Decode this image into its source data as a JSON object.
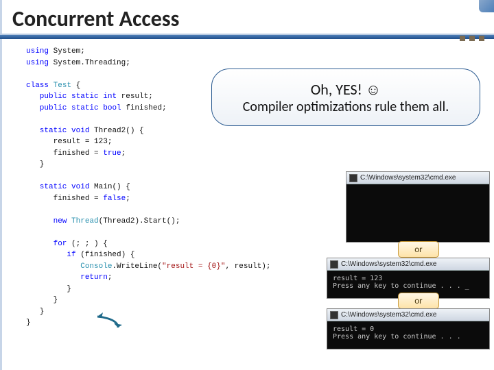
{
  "title": "Concurrent Access",
  "callout": {
    "line1": "Oh, YES! ☺",
    "line2": "Compiler optimizations rule them all."
  },
  "or_label": "or",
  "code": {
    "l01a": "using",
    "l01b": " System;",
    "l02a": "using",
    "l02b": " System.Threading;",
    "l03a": "class",
    "l03b": " Test",
    "l03c": " {",
    "l04a": "   public",
    "l04b": " static",
    "l04c": " int",
    "l04d": " result;",
    "l05a": "   public",
    "l05b": " static",
    "l05c": " bool",
    "l05d": " finished;",
    "l06a": "   static",
    "l06b": " void",
    "l06c": " Thread2() {",
    "l07": "      result = 123;",
    "l08a": "      finished = ",
    "l08b": "true",
    "l08c": ";",
    "l09": "   }",
    "l10a": "   static",
    "l10b": " void",
    "l10c": " Main() {",
    "l11a": "      finished = ",
    "l11b": "false",
    "l11c": ";",
    "l12a": "      new",
    "l12b": " Thread",
    "l12c": "(Thread2).Start();",
    "l13a": "      for",
    "l13b": " (; ; ) {",
    "l14a": "         if",
    "l14b": " (finished) {",
    "l15a": "            Console",
    "l15b": ".WriteLine(",
    "l15c": "\"result = {0}\"",
    "l15d": ", result);",
    "l16a": "            return",
    "l16b": ";",
    "l17": "         }",
    "l18": "      }",
    "l19": "   }",
    "l20": "}"
  },
  "console": {
    "title_full": "C:\\Windows\\system32\\cmd.exe",
    "title_short": "C:\\Windows\\system32\\cmd.exe",
    "out2": "result = 123\nPress any key to continue . . . _",
    "out3": "result = 0\nPress any key to continue . . ."
  }
}
